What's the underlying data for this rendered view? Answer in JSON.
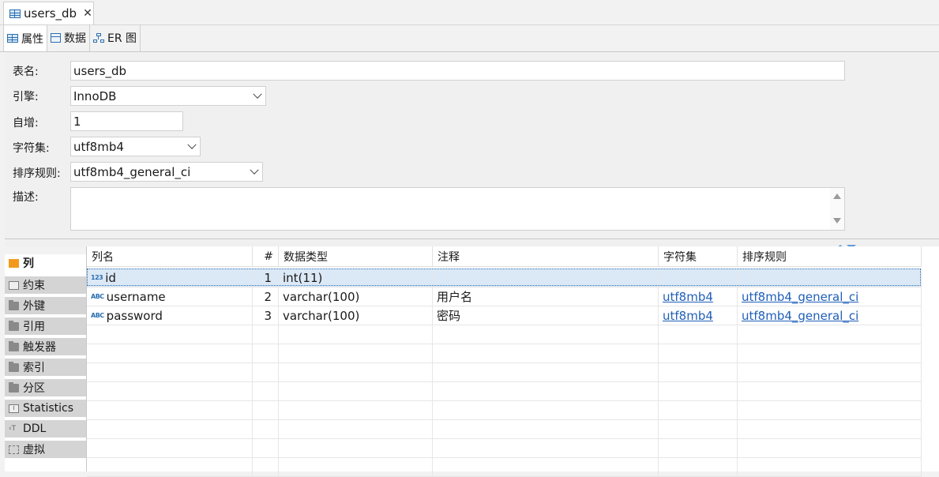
{
  "document_tab": {
    "title": "users_db",
    "close": "✕"
  },
  "subtabs": [
    {
      "label": "属性",
      "icon": "table-icon",
      "active": true
    },
    {
      "label": "数据",
      "icon": "data-icon",
      "active": false
    },
    {
      "label": "ER 图",
      "icon": "er-diagram-icon",
      "active": false
    }
  ],
  "form": {
    "table_name_label": "表名:",
    "table_name_value": "users_db",
    "engine_label": "引擎:",
    "engine_value": "InnoDB",
    "auto_inc_label": "自增:",
    "auto_inc_value": "1",
    "charset_label": "字符集:",
    "charset_value": "utf8mb4",
    "collation_label": "排序规则:",
    "collation_value": "utf8mb4_general_ci",
    "description_label": "描述:",
    "description_value": ""
  },
  "sidebar": {
    "items": [
      {
        "label": "列",
        "icon": "column-icon",
        "active": true
      },
      {
        "label": "约束",
        "icon": "constraint-icon"
      },
      {
        "label": "外键",
        "icon": "folder-icon"
      },
      {
        "label": "引用",
        "icon": "folder-icon"
      },
      {
        "label": "触发器",
        "icon": "folder-icon"
      },
      {
        "label": "索引",
        "icon": "folder-icon"
      },
      {
        "label": "分区",
        "icon": "folder-icon"
      },
      {
        "label": "Statistics",
        "icon": "info-icon"
      },
      {
        "label": "DDL",
        "icon": "ddl-icon"
      },
      {
        "label": "虚拟",
        "icon": "virtual-icon"
      }
    ]
  },
  "grid": {
    "headers": [
      "列名",
      "#",
      "数据类型",
      "注释",
      "字符集",
      "排序规则"
    ],
    "rows": [
      {
        "type_icon": "123",
        "name": "id",
        "num": "1",
        "datatype": "int(11)",
        "comment": "",
        "charset": "",
        "collation": "",
        "selected": true
      },
      {
        "type_icon": "ABC",
        "name": "username",
        "num": "2",
        "datatype": "varchar(100)",
        "comment": "用户名",
        "charset": "utf8mb4",
        "collation": "utf8mb4_general_ci"
      },
      {
        "type_icon": "ABC",
        "name": "password",
        "num": "3",
        "datatype": "varchar(100)",
        "comment": "密码",
        "charset": "utf8mb4",
        "collation": "utf8mb4_general_ci"
      }
    ]
  },
  "colors": {
    "accent": "#2a6fb0",
    "link": "#1f5fb8",
    "selection": "#dbe8f6",
    "column_icon": "#f39a1e"
  }
}
